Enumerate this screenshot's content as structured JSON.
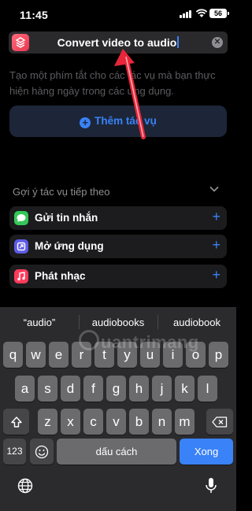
{
  "status_bar": {
    "time": "11:45",
    "battery": "56"
  },
  "title_field": {
    "value": "Convert video to audio"
  },
  "description": "Tạo một phím tắt cho các tác vụ mà bạn thực hiện hàng ngày trong các ứng dụng.",
  "add_action": {
    "label": "Thêm tác vụ"
  },
  "suggestions": {
    "heading": "Gợi ý tác vụ tiếp theo",
    "items": [
      {
        "label": "Gửi tin nhắn",
        "icon": "messages-icon",
        "color": "#34c759"
      },
      {
        "label": "Mở ứng dụng",
        "icon": "open-app-icon",
        "color": "#5e5ce6"
      },
      {
        "label": "Phát nhạc",
        "icon": "music-icon",
        "color": "#ff3b5c"
      }
    ]
  },
  "keyboard": {
    "predictions": [
      "“audio”",
      "audiobooks",
      "audiobook"
    ],
    "row1": [
      "q",
      "w",
      "e",
      "r",
      "t",
      "y",
      "u",
      "i",
      "o",
      "p"
    ],
    "row2": [
      "a",
      "s",
      "d",
      "f",
      "g",
      "h",
      "j",
      "k",
      "l"
    ],
    "row3": [
      "z",
      "x",
      "c",
      "v",
      "b",
      "n",
      "m"
    ],
    "numbers_label": "123",
    "space_label": "dấu cách",
    "return_label": "Xong"
  },
  "watermark": "uantrimang",
  "colors": {
    "accent": "#3a82f7",
    "annotation_arrow": "#e8263a"
  }
}
